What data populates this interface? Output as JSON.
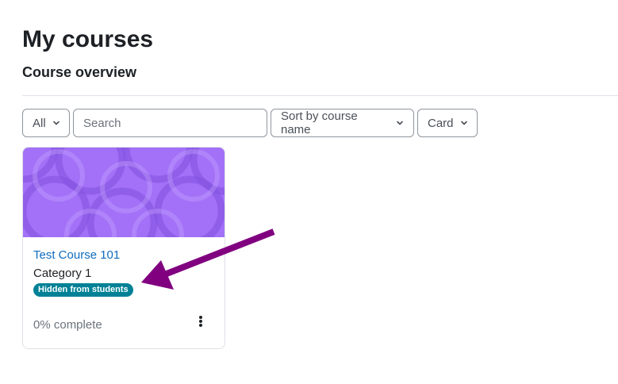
{
  "page": {
    "title": "My courses"
  },
  "overview": {
    "title": "Course overview",
    "filter": {
      "selected": "All",
      "icon": "chevron-down-icon"
    },
    "search": {
      "placeholder": "Search"
    },
    "sort": {
      "selected": "Sort by course name",
      "icon": "chevron-down-icon"
    },
    "view": {
      "selected": "Card",
      "icon": "chevron-down-icon"
    }
  },
  "courses": [
    {
      "name": "Test Course 101",
      "category": "Category 1",
      "badge": "Hidden from students",
      "progress": "0% complete",
      "progress_value": 0,
      "menu_icon": "kebab-menu-icon",
      "image_color": "#a371f7"
    }
  ],
  "annotation": {
    "type": "arrow",
    "color": "#800080"
  },
  "colors": {
    "link": "#0f6cbf",
    "badge": "#008196",
    "text": "#1d2125"
  }
}
